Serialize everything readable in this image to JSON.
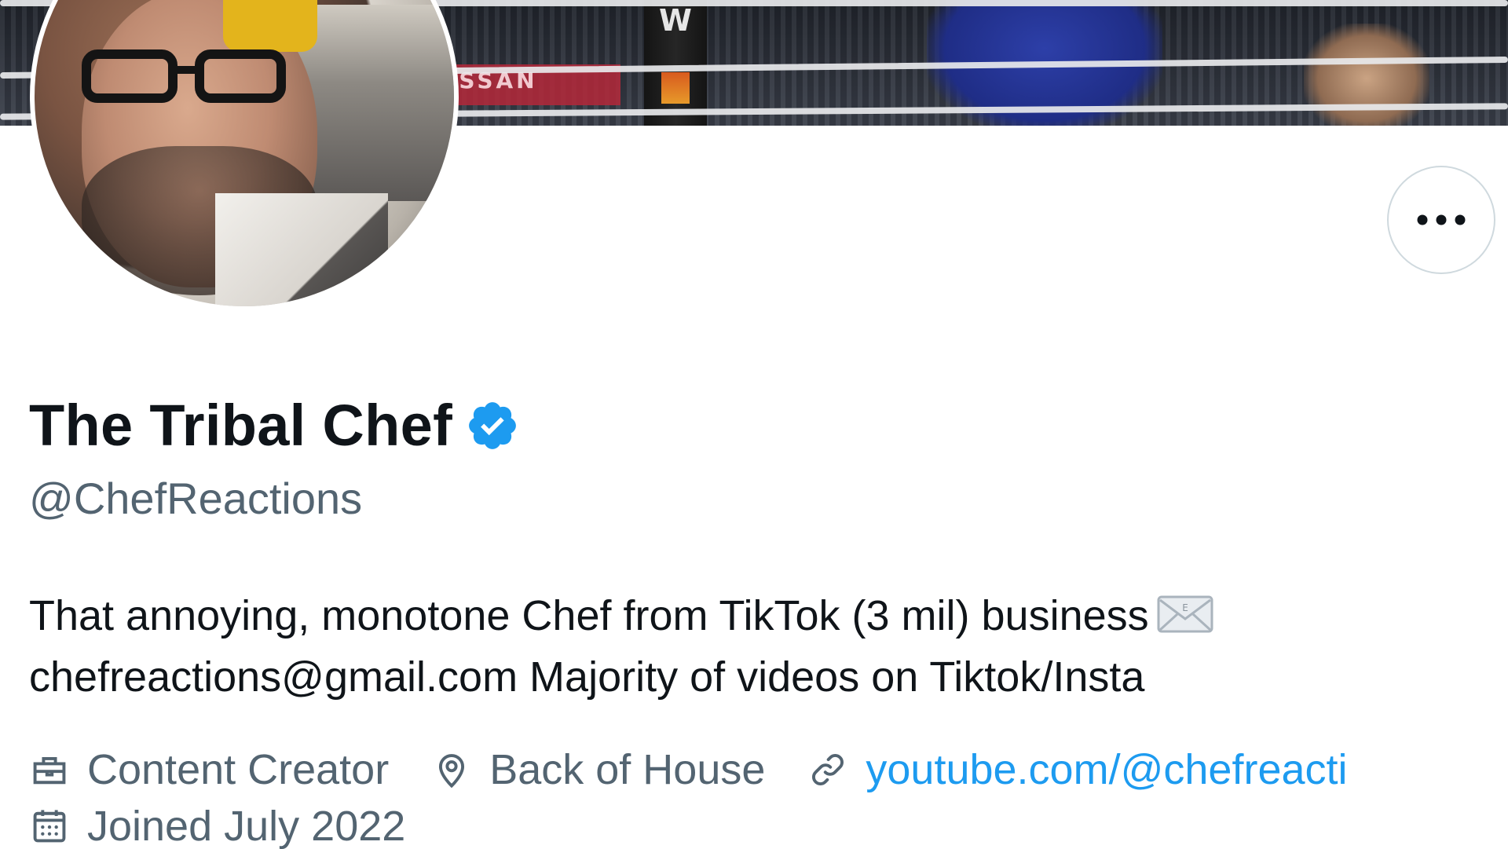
{
  "profile": {
    "display_name": "The Tribal Chef",
    "verified": true,
    "handle": "@ChefReactions",
    "bio_line_1": "That annoying, monotone Chef from TikTok (3 mil) business",
    "bio_line_2": "chefreactions@gmail.com Majority of videos on Tiktok/Insta",
    "occupation": "Content Creator",
    "location": "Back of House",
    "website": "youtube.com/@chefreacti",
    "joined": "Joined July 2022"
  },
  "banner": {
    "post_logo_text": "W",
    "sign_text": "ISSAN"
  },
  "icons": {
    "more": "more-horizontal-icon",
    "verified": "verified-badge-icon",
    "envelope": "envelope-icon",
    "occupation": "briefcase-icon",
    "location": "location-pin-icon",
    "website": "link-icon",
    "joined": "calendar-icon"
  },
  "colors": {
    "text_primary": "#0f1419",
    "text_secondary": "#536471",
    "link": "#1d9bf0",
    "verified": "#1d9bf0",
    "button_border": "#cfd9de"
  }
}
